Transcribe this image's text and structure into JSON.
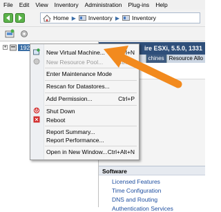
{
  "menubar": [
    "File",
    "Edit",
    "View",
    "Inventory",
    "Administration",
    "Plug-ins",
    "Help"
  ],
  "address": {
    "home": "Home",
    "inventory1": "Inventory",
    "inventory2": "Inventory"
  },
  "tree": {
    "host_label": "192"
  },
  "right_panel": {
    "header": "ire ESXi, 5.5.0, 1331",
    "tabs": [
      "chines",
      "Resource Allo"
    ],
    "software_title": "Software",
    "software_links": [
      "Licensed Features",
      "Time Configuration",
      "DNS and Routing",
      "Authentication Services"
    ]
  },
  "context_menu": {
    "items": [
      {
        "label": "New Virtual Machine...",
        "shortcut": "Ctrl+N",
        "enabled": true,
        "icon": "new-vm-icon"
      },
      {
        "label": "New Resource Pool...",
        "shortcut": "Ctrl+O",
        "enabled": false,
        "icon": "resource-pool-icon"
      },
      {
        "label": "Enter Maintenance Mode",
        "shortcut": "",
        "enabled": true,
        "icon": ""
      },
      {
        "label": "Rescan for Datastores...",
        "shortcut": "",
        "enabled": true,
        "icon": ""
      },
      {
        "label": "Add Permission...",
        "shortcut": "Ctrl+P",
        "enabled": true,
        "icon": ""
      },
      {
        "label": "Shut Down",
        "shortcut": "",
        "enabled": true,
        "icon": "shutdown-icon"
      },
      {
        "label": "Reboot",
        "shortcut": "",
        "enabled": true,
        "icon": "reboot-icon"
      },
      {
        "label": "Report Summary...",
        "shortcut": "",
        "enabled": true,
        "icon": ""
      },
      {
        "label": "Report Performance...",
        "shortcut": "",
        "enabled": true,
        "icon": ""
      },
      {
        "label": "Open in New Window...",
        "shortcut": "Ctrl+Alt+N",
        "enabled": true,
        "icon": ""
      }
    ]
  },
  "colors": {
    "accent_arrow": "#f28a1e",
    "header_bg": "#2f4f7a",
    "link": "#1f4fa0"
  }
}
